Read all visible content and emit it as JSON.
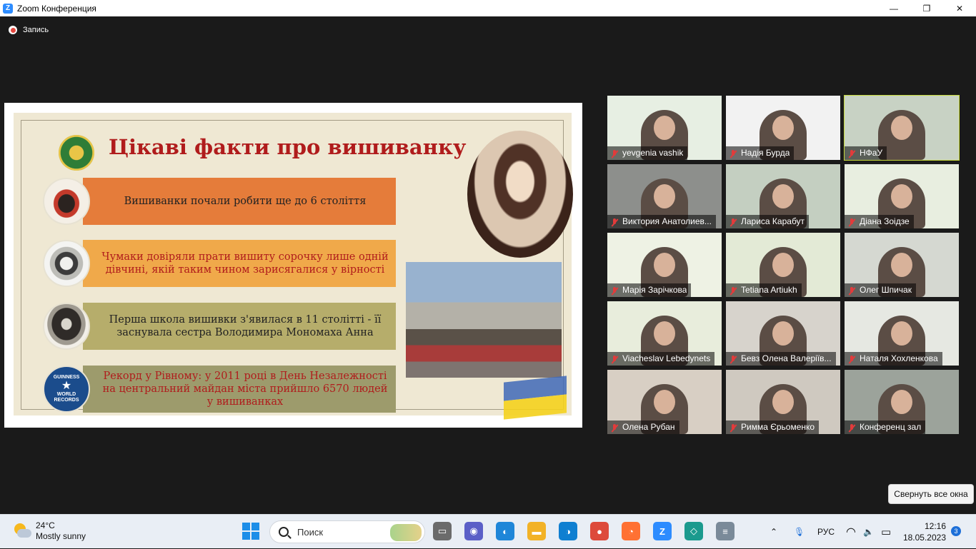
{
  "window": {
    "title": "Zoom Конференция",
    "logo": "Z",
    "minimize_glyph": "—",
    "maximize_glyph": "❐",
    "close_glyph": "✕"
  },
  "recording": {
    "label": "Запись"
  },
  "slide": {
    "title": "Цікаві факти про вишиванку",
    "facts": [
      {
        "text": "Вишиванки почали робити ще до 6 століття",
        "bar_color": "#e57c3a",
        "text_color": "#222222"
      },
      {
        "text": "Чумаки довіряли прати вишиту сорочку лише одній дівчині, якій таким чином зарисягалися у вірності",
        "bar_color": "#f0a94a",
        "text_color": "#b01c1c"
      },
      {
        "text": "Перша школа вишивки з'явилася в 11 столітті - її заснувала сестра Володимира Мономаха Анна",
        "bar_color": "#b6ad6b",
        "text_color": "#222222"
      },
      {
        "text": "Рекорд у Рівному: у 2011 році в День Незалежності на центральний майдан міста прийшло 6570 людей у вишиванках",
        "bar_color": "#9d9b6c",
        "text_color": "#b01c1c"
      }
    ],
    "guinness_line1": "GUINNESS",
    "guinness_line2": "WORLD RECORDS"
  },
  "participants": [
    {
      "name": "yevgenia vashik",
      "bg": "#e7efe3"
    },
    {
      "name": "Надія Бурда",
      "bg": "#f2f2f2"
    },
    {
      "name": "НФаУ",
      "bg": "#c8d2c4",
      "active": true
    },
    {
      "name": "Виктория Анатолиев...",
      "bg": "#8d8f8c"
    },
    {
      "name": "Лариса Карабут",
      "bg": "#c4cfc1"
    },
    {
      "name": "Діана Зоідзе",
      "bg": "#e8eee0"
    },
    {
      "name": "Марія Зарічкова",
      "bg": "#eef2e4"
    },
    {
      "name": "Tetiana Artiukh",
      "bg": "#e3ead6"
    },
    {
      "name": "Олег Шпичак",
      "bg": "#d5d8d1"
    },
    {
      "name": "Viacheslav Lebedynets",
      "bg": "#e8eddc"
    },
    {
      "name": "Бевз Олена Валеріїв...",
      "bg": "#d7d3cc"
    },
    {
      "name": "Наталя Хохленкова",
      "bg": "#e6e8e2"
    },
    {
      "name": "Олена Рубан",
      "bg": "#d8cfc4"
    },
    {
      "name": "Римма Єрьоменко",
      "bg": "#cfc9c0"
    },
    {
      "name": "Конференц зал",
      "bg": "#9ca39b"
    }
  ],
  "tooltip": "Свернуть все окна",
  "taskbar": {
    "weather_temp": "24°C",
    "weather_desc": "Mostly sunny",
    "search_placeholder": "Поиск",
    "language": "РУС",
    "time": "12:16",
    "date": "18.05.2023",
    "notification_count": "3",
    "tray_chevron": "⌃",
    "mic_glyph": "🎙",
    "wifi_glyph": "◠",
    "volume_glyph": "🔈",
    "battery_glyph": "▭",
    "apps": [
      {
        "name": "file-explorer-icon",
        "glyph": "▭",
        "color": "#6b6b6b"
      },
      {
        "name": "teams-chat-icon",
        "glyph": "◉",
        "color": "#5b5fc7"
      },
      {
        "name": "edge-browser-icon-1",
        "glyph": "◐",
        "color": "#1f86d8"
      },
      {
        "name": "folder-icon",
        "glyph": "▬",
        "color": "#f2b227"
      },
      {
        "name": "edge-browser-icon-2",
        "glyph": "◑",
        "color": "#0f7fd1"
      },
      {
        "name": "chrome-icon",
        "glyph": "●",
        "color": "#dd4a3b"
      },
      {
        "name": "firefox-icon",
        "glyph": "◔",
        "color": "#ff7133"
      },
      {
        "name": "zoom-icon",
        "glyph": "Z",
        "color": "#2d8cff"
      },
      {
        "name": "teal-app-icon",
        "glyph": "◇",
        "color": "#1b9a8e"
      },
      {
        "name": "notepad-icon",
        "glyph": "≡",
        "color": "#7a8a99"
      }
    ]
  }
}
